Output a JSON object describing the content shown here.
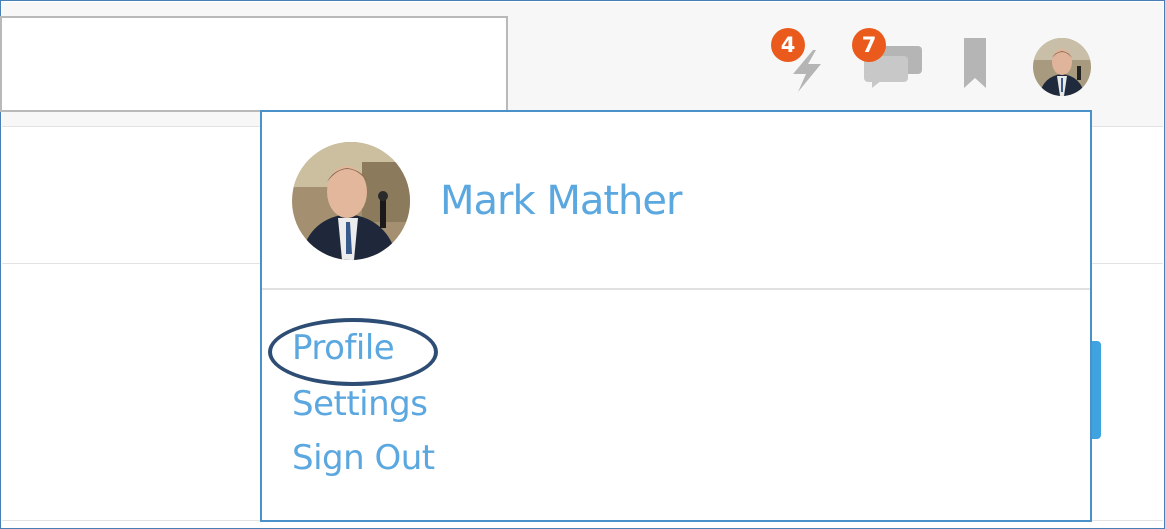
{
  "header": {
    "search_value": "",
    "notifications": {
      "icon": "lightning-icon",
      "count": "4"
    },
    "messages": {
      "icon": "chat-icon",
      "count": "7"
    },
    "bookmarks": {
      "icon": "bookmark-icon"
    },
    "avatar": {
      "icon": "avatar"
    }
  },
  "dropdown": {
    "user_name": "Mark Mather",
    "menu": [
      {
        "label": "Profile"
      },
      {
        "label": "Settings"
      },
      {
        "label": "Sign Out"
      }
    ]
  },
  "colors": {
    "link": "#5ba7e0",
    "badge": "#ea5a1c",
    "icon_gray": "#b5b5b5",
    "highlight_ring": "#2e4d75",
    "dropdown_border": "#4a90c9"
  }
}
